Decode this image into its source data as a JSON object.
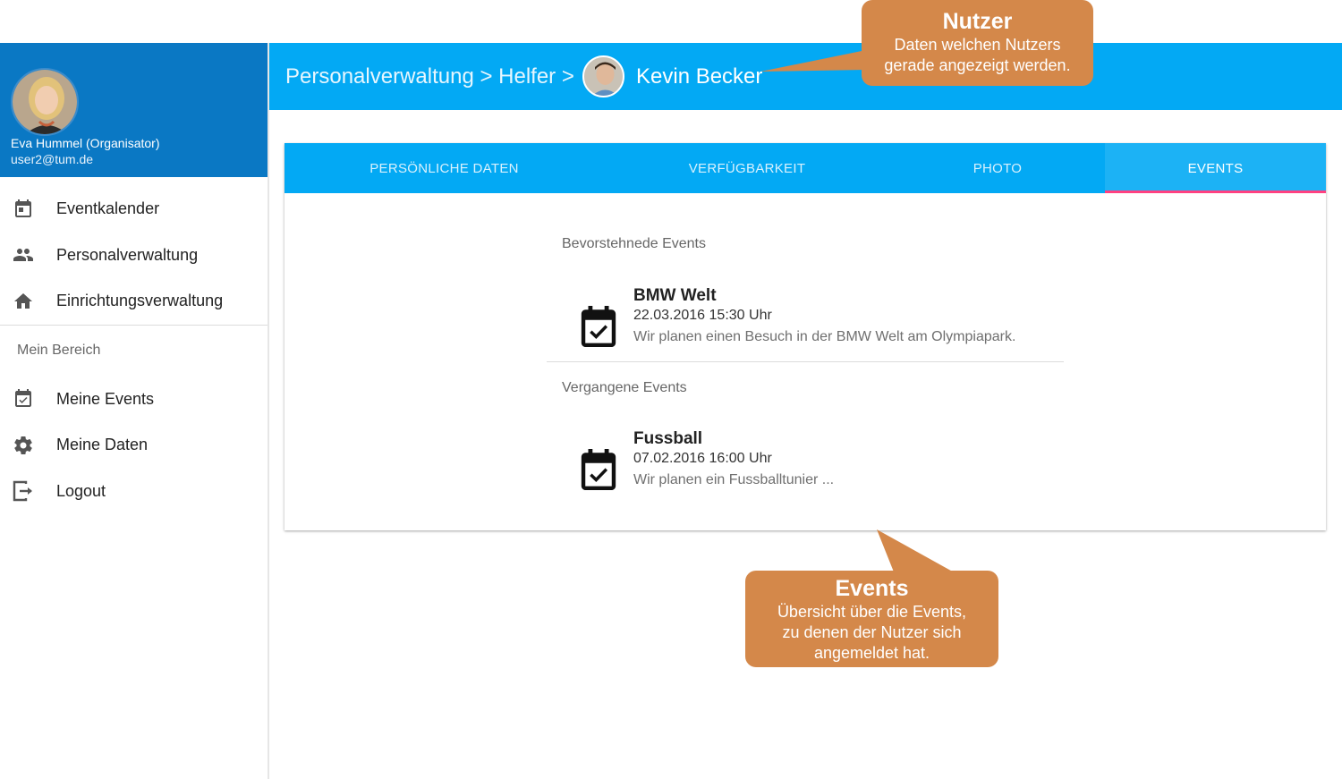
{
  "sidebar": {
    "profile": {
      "name": "Eva Hummel (Organisator)",
      "email": "user2@tum.de"
    },
    "items": [
      {
        "label": "Eventkalender",
        "icon": "calendar-icon"
      },
      {
        "label": "Personalverwaltung",
        "icon": "people-icon"
      },
      {
        "label": "Einrichtungsverwaltung",
        "icon": "home-icon"
      }
    ],
    "section_label": "Mein Bereich",
    "my_items": [
      {
        "label": "Meine Events",
        "icon": "event-available-icon"
      },
      {
        "label": "Meine Daten",
        "icon": "gear-icon"
      },
      {
        "label": "Logout",
        "icon": "logout-icon"
      }
    ]
  },
  "header": {
    "breadcrumb": "Personalverwaltung > Helfer >",
    "user_name": "Kevin Becker"
  },
  "tabs": [
    {
      "label": "PERSÖNLICHE DATEN",
      "active": false
    },
    {
      "label": "VERFÜGBARKEIT",
      "active": false
    },
    {
      "label": "PHOTO",
      "active": false
    },
    {
      "label": "EVENTS",
      "active": true
    }
  ],
  "events": {
    "upcoming_title": "Bevorstehnede Events",
    "upcoming": [
      {
        "title": "BMW Welt",
        "date": "22.03.2016 15:30 Uhr",
        "description": "Wir planen einen Besuch in der BMW Welt am Olympiapark."
      }
    ],
    "past_title": "Vergangene Events",
    "past": [
      {
        "title": "Fussball",
        "date": "07.02.2016 16:00 Uhr",
        "description": "Wir planen ein Fussballtunier ..."
      }
    ]
  },
  "callouts": {
    "user": {
      "title": "Nutzer",
      "text_line1": "Daten welchen Nutzers",
      "text_line2": "gerade angezeigt werden."
    },
    "events": {
      "title": "Events",
      "text_line1": "Übersicht über die Events,",
      "text_line2": "zu denen der Nutzer sich",
      "text_line3": "angemeldet hat."
    }
  },
  "colors": {
    "primary": "#03a9f4",
    "sidebar_header": "#0a78c4",
    "tab_indicator": "#ff4081",
    "callout": "#d4884a"
  }
}
